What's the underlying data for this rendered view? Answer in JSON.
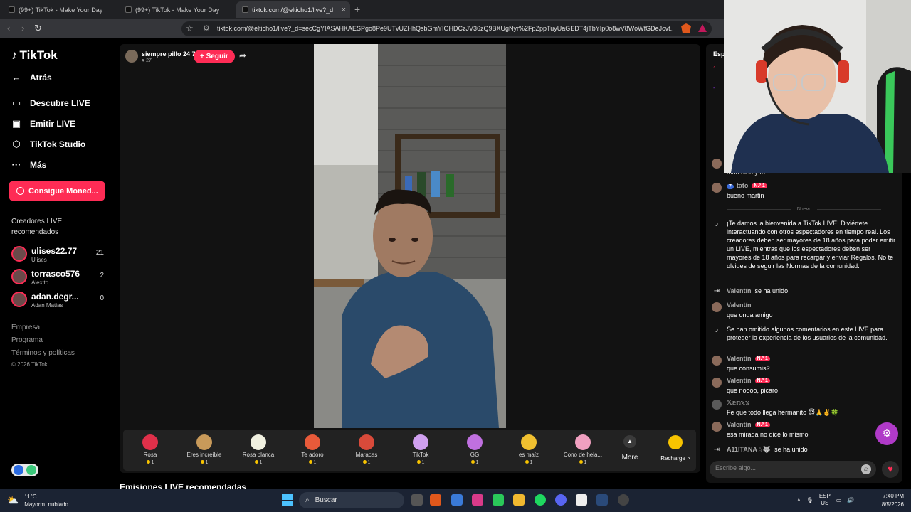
{
  "browser": {
    "tabs": [
      {
        "label": "(99+) TikTok - Make Your Day"
      },
      {
        "label": "(99+) TikTok - Make Your Day"
      },
      {
        "label": "tiktok.com/@elticho1/live?_d"
      }
    ],
    "url": "tiktok.com/@elticho1/live?_d=secCgYIASAHKAESPgo8Pe9UTvUZHhQsbGmYIOHDCzJV36zQ9BXUgNyr%2FpZppTuyUaGEDT4jTbYIp0o8wV8WoWfGDeJcvt..."
  },
  "sidebar": {
    "logo": "TikTok",
    "back": "Atrás",
    "nav": [
      {
        "label": "Descubre LIVE",
        "icon": "live-icon"
      },
      {
        "label": "Emitir LIVE",
        "icon": "camera-icon"
      },
      {
        "label": "TikTok Studio",
        "icon": "studio-icon"
      },
      {
        "label": "Más",
        "icon": "more-icon"
      }
    ],
    "coins_button": "Consigue Moned...",
    "creators_title": "Creadores LIVE recomendados",
    "creators": [
      {
        "name": "ulises22.77",
        "sub": "Ulises",
        "count": "21"
      },
      {
        "name": "torrasco576",
        "sub": "Alexito",
        "count": "2"
      },
      {
        "name": "adan.degr...",
        "sub": "Adan Matias",
        "count": "0"
      }
    ],
    "footer": [
      "Empresa",
      "Programa",
      "Términos y políticas",
      "© 2026 TikTok"
    ]
  },
  "stream": {
    "streamer_name": "siempre pillo 24 7",
    "likes": "27",
    "follow_label": "+ Seguir",
    "gifts": [
      {
        "name": "Rosa",
        "price": "1",
        "color": "#e0304a"
      },
      {
        "name": "Eres increíble",
        "price": "1",
        "color": "#c89a5a"
      },
      {
        "name": "Rosa blanca",
        "price": "1",
        "color": "#f0f0e0"
      },
      {
        "name": "Te adoro",
        "price": "1",
        "color": "#e85a3a"
      },
      {
        "name": "Maracas",
        "price": "1",
        "color": "#d84a3a"
      },
      {
        "name": "TikTok",
        "price": "1",
        "color": "#d0a0f0"
      },
      {
        "name": "GG",
        "price": "1",
        "color": "#c070e0"
      },
      {
        "name": "es maíz",
        "price": "1",
        "color": "#f0c030"
      },
      {
        "name": "Cono de hela...",
        "price": "1",
        "color": "#f0a0c0"
      }
    ],
    "more_label": "More",
    "recharge_label": "Recharge",
    "recommended": "Emisiones LIVE recomendadas"
  },
  "chat": {
    "header": "Esp",
    "nuevo": "Nuevo",
    "partial_text": "todo bien y tu",
    "messages": [
      {
        "type": "user",
        "level": "7",
        "user": "tato",
        "badge": "N.º 1",
        "text": "bueno martin"
      },
      {
        "type": "system",
        "text": "¡Te damos la bienvenida a TikTok LIVE! Diviértete interactuando con otros espectadores en tiempo real. Los creadores deben ser mayores de 18 años para poder emitir un LIVE, mientras que los espectadores deben ser mayores de 18 años para recargar y enviar Regalos. No te olvides de seguir las Normas de la comunidad."
      },
      {
        "type": "join",
        "user": "Valentín",
        "text": "se ha unido"
      },
      {
        "type": "user",
        "user": "Valentín",
        "text": "que onda amigo"
      },
      {
        "type": "system",
        "text": "Se han omitido algunos comentarios en este LIVE para proteger la experiencia de los usuarios de la comunidad."
      },
      {
        "type": "user",
        "user": "Valentín",
        "badge": "N.º 1",
        "text": "que consumis?"
      },
      {
        "type": "user",
        "user": "Valentín",
        "badge": "N.º 1",
        "text": "que noooo, picaro"
      },
      {
        "type": "user",
        "user": "𝕏𝕖𝕟𝕩𝕩",
        "text": "Fe que todo llega hermanito 😇🙏✌️🍀"
      },
      {
        "type": "user",
        "user": "Valentín",
        "badge": "N.º 1",
        "text": "esa mirada no dice lo mismo"
      },
      {
        "type": "join",
        "user": "A11ITANA☆🐺",
        "text": "se ha unido"
      }
    ],
    "input_placeholder": "Escribe algo..."
  },
  "taskbar": {
    "weather_temp": "11°C",
    "weather_desc": "Mayorm. nublado",
    "search": "Buscar",
    "lang": "ESP",
    "region": "US",
    "time": "7:40 PM",
    "date": "8/5/2026"
  }
}
